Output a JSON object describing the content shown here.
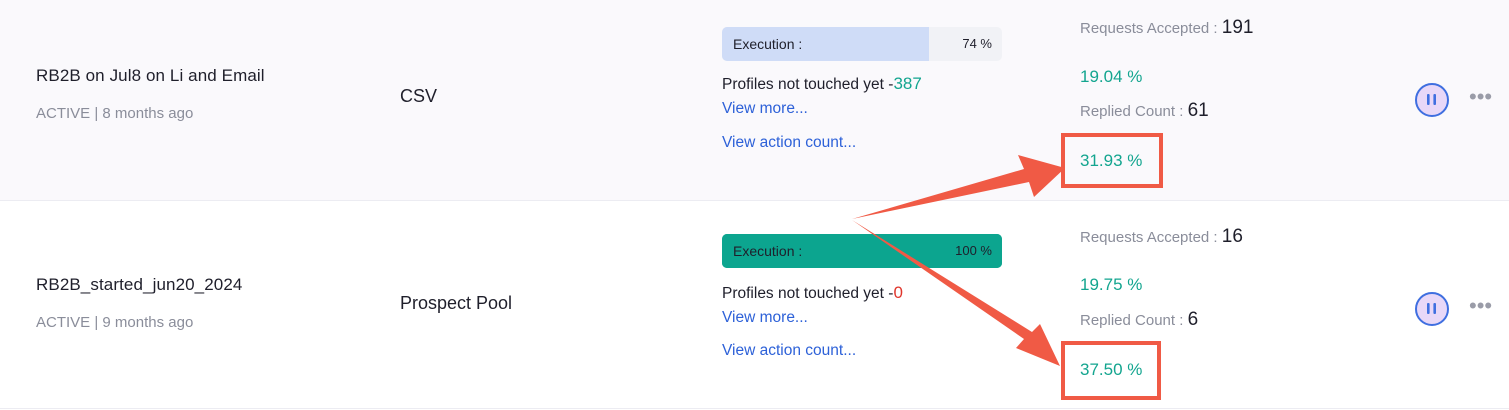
{
  "campaigns": [
    {
      "name": "RB2B on Jul8 on Li and Email",
      "status": "ACTIVE | 8 months ago",
      "source": "CSV",
      "execution": {
        "label": "Execution :",
        "percent_text": "74 %",
        "progress": 74
      },
      "profiles_label": "Profiles not touched yet -",
      "profiles_value": "387",
      "view_more": "View more...",
      "view_action_count": "View action count...",
      "requests_accepted_label": "Requests Accepted :",
      "requests_accepted_value": "191",
      "accepted_rate": "19.04 %",
      "replied_label": "Replied Count :",
      "replied_value": "61",
      "replied_rate": "31.93 %"
    },
    {
      "name": "RB2B_started_jun20_2024",
      "status": "ACTIVE | 9 months ago",
      "source": "Prospect Pool",
      "execution": {
        "label": "Execution :",
        "percent_text": "100 %",
        "progress": 100
      },
      "profiles_label": "Profiles not touched yet -",
      "profiles_value": "0",
      "view_more": "View more...",
      "view_action_count": "View action count...",
      "requests_accepted_label": "Requests Accepted :",
      "requests_accepted_value": "16",
      "accepted_rate": "19.75 %",
      "replied_label": "Replied Count :",
      "replied_value": "6",
      "replied_rate": "37.50 %"
    }
  ],
  "icons": {
    "pause": "pause-icon",
    "more": "more-horizontal-icon"
  },
  "colors": {
    "accent_teal": "#13a58f",
    "link_blue": "#2d61d8",
    "highlight": "#f05a45",
    "zero_red": "#e0362c"
  }
}
